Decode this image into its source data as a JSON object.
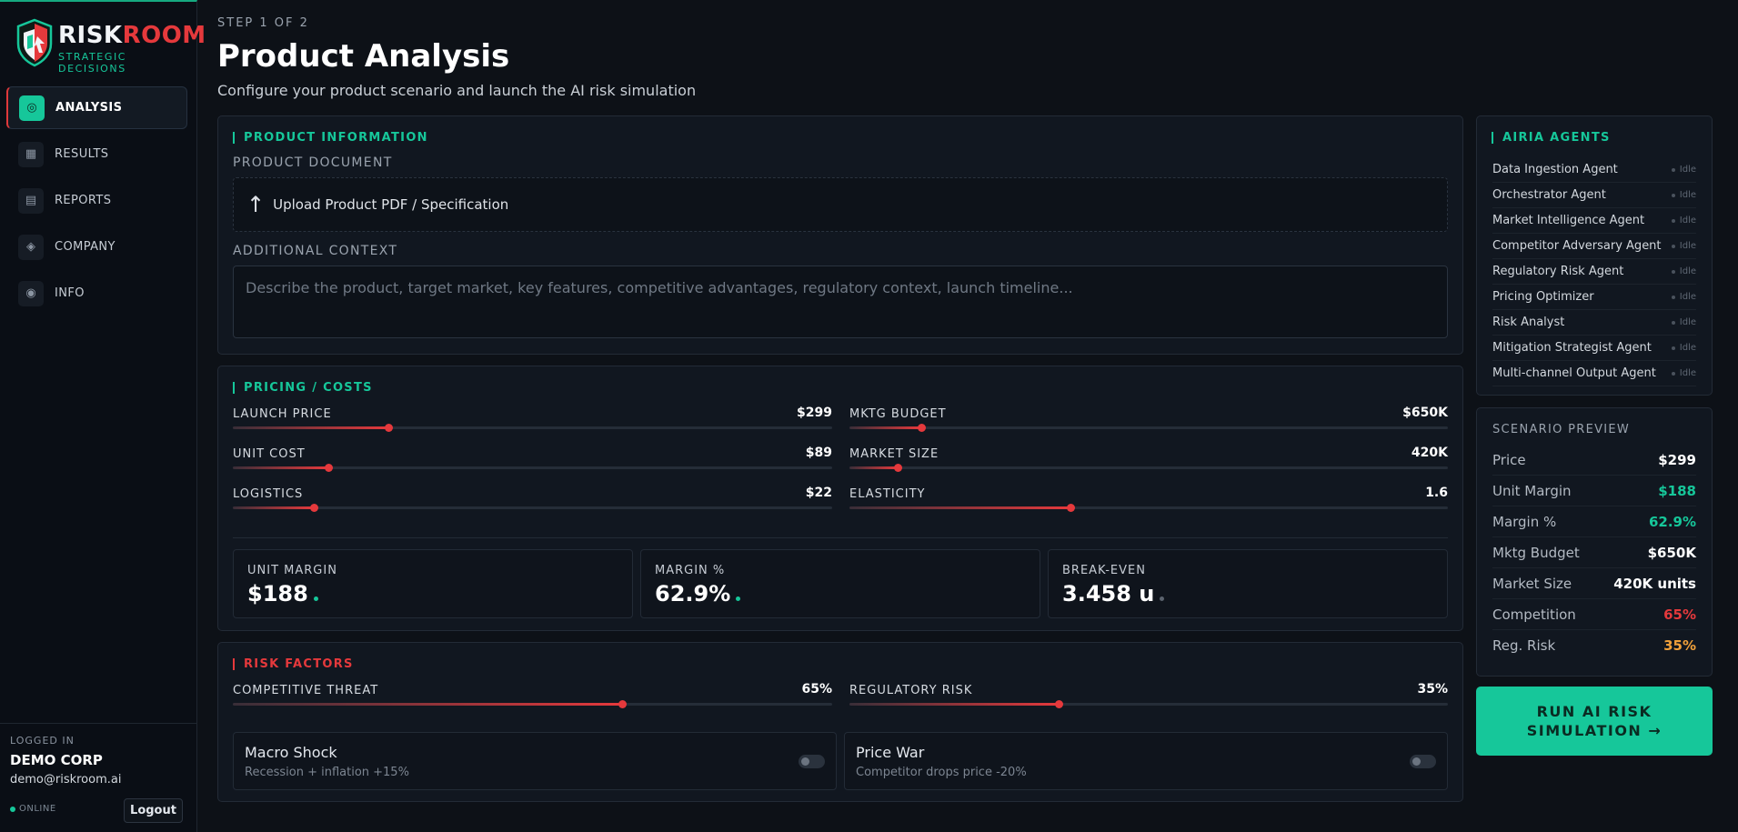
{
  "brand": {
    "name_part1": "RISK",
    "name_part2": "ROOM",
    "tagline": "STRATEGIC DECISIONS"
  },
  "nav": [
    {
      "label": "ANALYSIS",
      "icon": "target-icon",
      "glyph": "◎",
      "active": true
    },
    {
      "label": "RESULTS",
      "icon": "grid-icon",
      "glyph": "▦",
      "active": false
    },
    {
      "label": "REPORTS",
      "icon": "document-icon",
      "glyph": "▤",
      "active": false
    },
    {
      "label": "COMPANY",
      "icon": "diamond-icon",
      "glyph": "◈",
      "active": false
    },
    {
      "label": "INFO",
      "icon": "info-circle-icon",
      "glyph": "◉",
      "active": false
    }
  ],
  "user": {
    "logged_label": "LOGGED IN",
    "name": "DEMO CORP",
    "email": "demo@riskroom.ai",
    "status": "ONLINE",
    "logout": "Logout"
  },
  "header": {
    "step": "STEP 1 OF 2",
    "title": "Product Analysis",
    "subtitle": "Configure your product scenario and launch the AI risk simulation"
  },
  "product": {
    "heading": "PRODUCT INFORMATION",
    "doc_label": "PRODUCT DOCUMENT",
    "upload_arrow": "↑",
    "upload_text": "Upload Product PDF / Specification",
    "context_label": "ADDITIONAL CONTEXT",
    "context_placeholder": "Describe the product, target market, key features, competitive advantages, regulatory context, launch timeline..."
  },
  "pricing": {
    "heading": "PRICING / COSTS",
    "sliders": [
      {
        "label": "LAUNCH PRICE",
        "value": "$299",
        "level": 0.26
      },
      {
        "label": "MKTG BUDGET",
        "value": "$650K",
        "level": 0.12
      },
      {
        "label": "UNIT COST",
        "value": "$89",
        "level": 0.16
      },
      {
        "label": "MARKET SIZE",
        "value": "420K",
        "level": 0.08
      },
      {
        "label": "LOGISTICS",
        "value": "$22",
        "level": 0.135
      },
      {
        "label": "ELASTICITY",
        "value": "1.6",
        "level": 0.37
      }
    ],
    "stats": [
      {
        "label": "UNIT MARGIN",
        "value": "$188",
        "dot": "#16c79a"
      },
      {
        "label": "MARGIN %",
        "value": "62.9%",
        "dot": "#16c79a"
      },
      {
        "label": "BREAK-EVEN",
        "value": "3.458 u",
        "dot": "#5a626d"
      }
    ]
  },
  "risk": {
    "heading": "RISK FACTORS",
    "sliders": [
      {
        "label": "COMPETITIVE THREAT",
        "value": "65%",
        "level": 0.65
      },
      {
        "label": "REGULATORY RISK",
        "value": "35%",
        "level": 0.35
      }
    ],
    "toggles": [
      {
        "title": "Macro Shock",
        "sub": "Recession + inflation +15%",
        "on": false
      },
      {
        "title": "Price War",
        "sub": "Competitor drops price -20%",
        "on": false
      }
    ]
  },
  "agents": {
    "heading": "AIRIA AGENTS",
    "items": [
      {
        "name": "Data Ingestion Agent",
        "status": "Idle"
      },
      {
        "name": "Orchestrator Agent",
        "status": "Idle"
      },
      {
        "name": "Market Intelligence Agent",
        "status": "Idle"
      },
      {
        "name": "Competitor Adversary Agent",
        "status": "Idle"
      },
      {
        "name": "Regulatory Risk Agent",
        "status": "Idle"
      },
      {
        "name": "Pricing Optimizer",
        "status": "Idle"
      },
      {
        "name": "Risk Analyst",
        "status": "Idle"
      },
      {
        "name": "Mitigation Strategist Agent",
        "status": "Idle"
      },
      {
        "name": "Multi-channel Output Agent",
        "status": "Idle"
      }
    ]
  },
  "preview": {
    "heading": "SCENARIO PREVIEW",
    "rows": [
      {
        "key": "Price",
        "value": "$299",
        "color": "#ffffff"
      },
      {
        "key": "Unit Margin",
        "value": "$188",
        "color": "#16c79a"
      },
      {
        "key": "Margin %",
        "value": "62.9%",
        "color": "#16c79a"
      },
      {
        "key": "Mktg Budget",
        "value": "$650K",
        "color": "#ffffff"
      },
      {
        "key": "Market Size",
        "value": "420K units",
        "color": "#ffffff"
      },
      {
        "key": "Competition",
        "value": "65%",
        "color": "#e5393c"
      },
      {
        "key": "Reg. Risk",
        "value": "35%",
        "color": "#f0a03a"
      }
    ]
  },
  "run_button": {
    "line1": "RUN AI RISK",
    "line2": "SIMULATION →"
  }
}
